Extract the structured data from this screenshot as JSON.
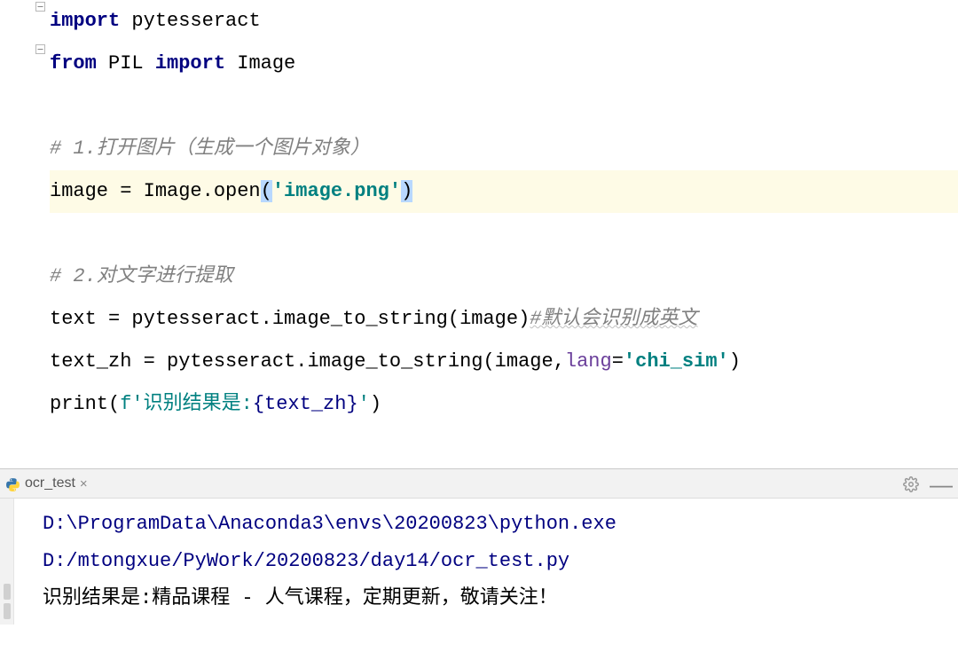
{
  "code": {
    "l1": {
      "import": "import",
      "mod": " pytesseract"
    },
    "l2": {
      "from": "from",
      "pkg": " PIL ",
      "import": "import",
      "mod": " Image"
    },
    "l4": "# 1.打开图片（生成一个图片对象）",
    "l5": {
      "a": "image = Image.open",
      "p1": "(",
      "str": "'image.png'",
      "p2": ")"
    },
    "l7": "# 2.对文字进行提取",
    "l8": {
      "a": "text = pytesseract.image_to_string(image)",
      "c": "#默认会识别成英文"
    },
    "l9": {
      "a": "text_zh = pytesseract.image_to_string(image,",
      "param": "lang",
      "eq": "=",
      "str": "'chi_sim'",
      "b": ")"
    },
    "l10": {
      "a": "print(",
      "f": "f'识别结果是:",
      "b": "{text_zh}",
      "c": "'",
      "d": ")"
    }
  },
  "tab": {
    "name": "ocr_test"
  },
  "console": {
    "path1": "D:\\ProgramData\\Anaconda3\\envs\\20200823\\python.exe",
    "path2": " D:/mtongxue/PyWork/20200823/day14/ocr_test.py",
    "out": "识别结果是:精品课程 - 人气课程，定期更新，敬请关注！"
  }
}
